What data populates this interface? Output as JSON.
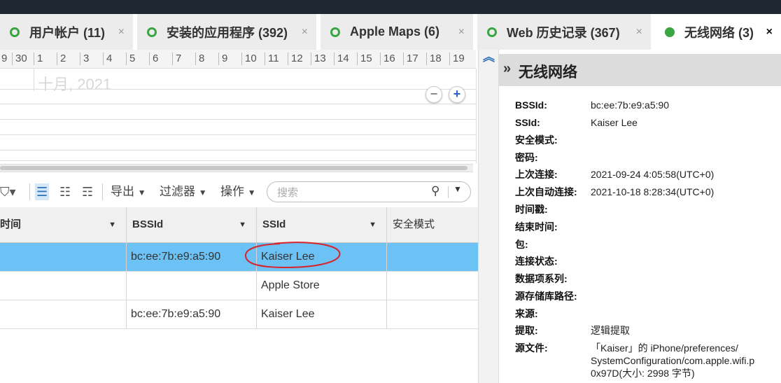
{
  "tabs": [
    {
      "label": "用户帐户 (11)",
      "active": false
    },
    {
      "label": "安装的应用程序 (392)",
      "active": false
    },
    {
      "label": "Apple Maps (6)",
      "active": false
    },
    {
      "label": "Web 历史记录 (367)",
      "active": false
    },
    {
      "label": "无线网络 (3)",
      "active": true
    }
  ],
  "tab_close_glyph": "×",
  "timeline": {
    "ticks": [
      "9",
      "30",
      "1",
      "2",
      "3",
      "4",
      "5",
      "6",
      "7",
      "8",
      "9",
      "10",
      "11",
      "12",
      "13",
      "14",
      "15",
      "16",
      "17",
      "18",
      "19"
    ],
    "month_label": "十月, 2021",
    "zoom_out": "−",
    "zoom_in": "+"
  },
  "toolbar": {
    "tag_icon": "tag-icon",
    "export_label": "导出",
    "filter_label": "过滤器",
    "actions_label": "操作",
    "search_placeholder": "搜索"
  },
  "grid": {
    "columns": [
      "时间",
      "BSSId",
      "SSId",
      "安全模式"
    ],
    "rows": [
      {
        "time": "",
        "bssid": "bc:ee:7b:e9:a5:90",
        "ssid": "Kaiser Lee",
        "security": "",
        "selected": true
      },
      {
        "time": "",
        "bssid": "",
        "ssid": "Apple Store",
        "security": "",
        "selected": false
      },
      {
        "time": "",
        "bssid": "bc:ee:7b:e9:a5:90",
        "ssid": "Kaiser Lee",
        "security": "",
        "selected": false
      }
    ]
  },
  "details": {
    "title": "无线网络",
    "rows": [
      {
        "key": "BSSId:",
        "value": "bc:ee:7b:e9:a5:90"
      },
      {
        "key": "SSId:",
        "value": "Kaiser Lee"
      },
      {
        "key": "安全模式:",
        "value": ""
      },
      {
        "key": "密码:",
        "value": ""
      },
      {
        "key": "上次连接:",
        "value": "2021-09-24 4:05:58(UTC+0)"
      },
      {
        "key": "上次自动连接:",
        "value": "2021-10-18 8:28:34(UTC+0)"
      },
      {
        "key": "时间戳:",
        "value": ""
      },
      {
        "key": "结束时间:",
        "value": ""
      },
      {
        "key": "包:",
        "value": ""
      },
      {
        "key": "连接状态:",
        "value": ""
      },
      {
        "key": "数据项系列:",
        "value": ""
      },
      {
        "key": "源存储库路径:",
        "value": ""
      },
      {
        "key": "来源:",
        "value": ""
      },
      {
        "key": "提取:",
        "value": "逻辑提取"
      },
      {
        "key": "源文件:",
        "value": "「Kaiser」的 iPhone/preferences/\nSystemConfiguration/com.apple.wifi.p\n0x97D(大小: 2998 字节)"
      }
    ]
  },
  "colors": {
    "accent": "#3aa543",
    "selection": "#6cc1f5",
    "annotation": "#d9232a"
  }
}
